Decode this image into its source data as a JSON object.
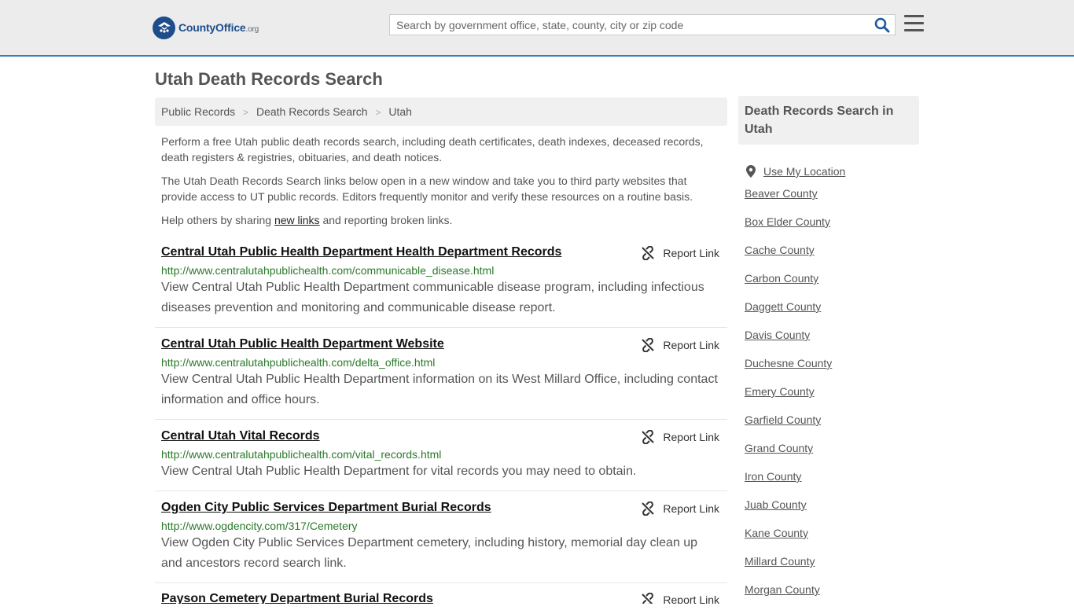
{
  "header": {
    "logo_brand": "CountyOffice",
    "logo_tld": ".org",
    "search_placeholder": "Search by government office, state, county, city or zip code"
  },
  "page": {
    "title": "Utah Death Records Search"
  },
  "breadcrumb": [
    "Public Records",
    "Death Records Search",
    "Utah"
  ],
  "intro": {
    "p1": "Perform a free Utah public death records search, including death certificates, death indexes, deceased records, death registers & registries, obituaries, and death notices.",
    "p2": "The Utah Death Records Search links below open in a new window and take you to third party websites that provide access to UT public records. Editors frequently monitor and verify these resources on a routine basis.",
    "p3_before": "Help others by sharing ",
    "p3_link": "new links",
    "p3_after": " and reporting broken links."
  },
  "report_label": "Report Link",
  "results": [
    {
      "title": "Central Utah Public Health Department Health Department Records",
      "url": "http://www.centralutahpublichealth.com/communicable_disease.html",
      "desc": "View Central Utah Public Health Department communicable disease program, including infectious diseases prevention and monitoring and communicable disease report."
    },
    {
      "title": "Central Utah Public Health Department Website",
      "url": "http://www.centralutahpublichealth.com/delta_office.html",
      "desc": "View Central Utah Public Health Department information on its West Millard Office, including contact information and office hours."
    },
    {
      "title": "Central Utah Vital Records",
      "url": "http://www.centralutahpublichealth.com/vital_records.html",
      "desc": "View Central Utah Public Health Department for vital records you may need to obtain."
    },
    {
      "title": "Ogden City Public Services Department Burial Records",
      "url": "http://www.ogdencity.com/317/Cemetery",
      "desc": "View Ogden City Public Services Department cemetery, including history, memorial day clean up and ancestors record search link."
    },
    {
      "title": "Payson Cemetery Department Burial Records",
      "url": "",
      "desc": ""
    }
  ],
  "sidebar": {
    "heading": "Death Records Search in Utah",
    "location_label": "Use My Location",
    "counties": [
      "Beaver County",
      "Box Elder County",
      "Cache County",
      "Carbon County",
      "Daggett County",
      "Davis County",
      "Duchesne County",
      "Emery County",
      "Garfield County",
      "Grand County",
      "Iron County",
      "Juab County",
      "Kane County",
      "Millard County",
      "Morgan County"
    ]
  }
}
